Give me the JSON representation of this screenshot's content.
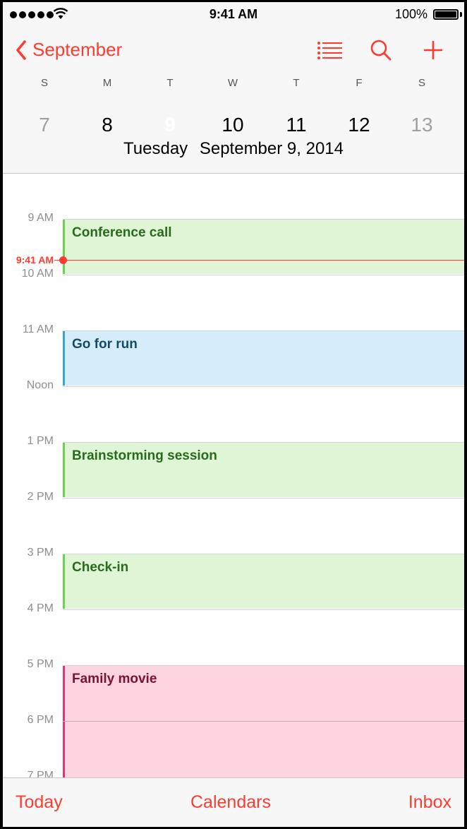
{
  "status_bar": {
    "time": "9:41 AM",
    "battery_text": "100%",
    "signal_bars": 5,
    "icons": [
      "signal-icon",
      "wifi-icon",
      "battery-icon"
    ]
  },
  "header": {
    "back_label": "September",
    "icons": [
      "list-icon",
      "search-icon",
      "add-icon"
    ],
    "accent_color": "#ff3b30"
  },
  "week": [
    {
      "dow": "S",
      "day": "7"
    },
    {
      "dow": "M",
      "day": "8"
    },
    {
      "dow": "T",
      "day": "9"
    },
    {
      "dow": "W",
      "day": "10"
    },
    {
      "dow": "T",
      "day": "11"
    },
    {
      "dow": "F",
      "day": "12"
    },
    {
      "dow": "S",
      "day": "13"
    }
  ],
  "selected_day": "9",
  "selected_date": {
    "weekday": "Tuesday",
    "date": "September 9, 2014"
  },
  "timeline": {
    "hours": [
      "9 AM",
      "10 AM",
      "11 AM",
      "Noon",
      "1 PM",
      "2 PM",
      "3 PM",
      "4 PM",
      "5 PM",
      "6 PM",
      "7 PM"
    ],
    "now_label": "9:41 AM",
    "events": [
      {
        "title": "Conference call",
        "color": "green"
      },
      {
        "title": "Go for run",
        "color": "blue"
      },
      {
        "title": "Brainstorming session",
        "color": "green"
      },
      {
        "title": "Check-in",
        "color": "green"
      },
      {
        "title": "Family movie",
        "color": "pink"
      }
    ]
  },
  "tabbar": {
    "today": "Today",
    "calendars": "Calendars",
    "inbox": "Inbox"
  }
}
